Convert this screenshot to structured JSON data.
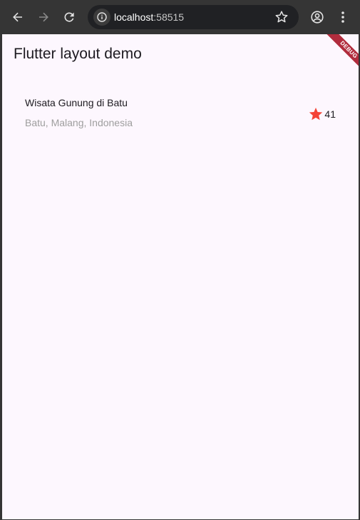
{
  "browser": {
    "url_host": "localhost",
    "url_port": ":58515"
  },
  "app": {
    "title": "Flutter layout demo",
    "debug_banner": "DEBUG"
  },
  "title_section": {
    "name": "Wisata Gunung di Batu",
    "location": "Batu, Malang, Indonesia",
    "favorite_count": "41",
    "star_color": "#f44336"
  },
  "colors": {
    "page_background": "#fdf7fe",
    "toolbar_background": "#353535",
    "debug_banner": "#b12c3d"
  },
  "icons": [
    "back-arrow-icon",
    "forward-arrow-icon",
    "reload-icon",
    "info-icon",
    "bookmark-star-icon",
    "profile-icon",
    "more-vert-icon",
    "star-icon"
  ]
}
